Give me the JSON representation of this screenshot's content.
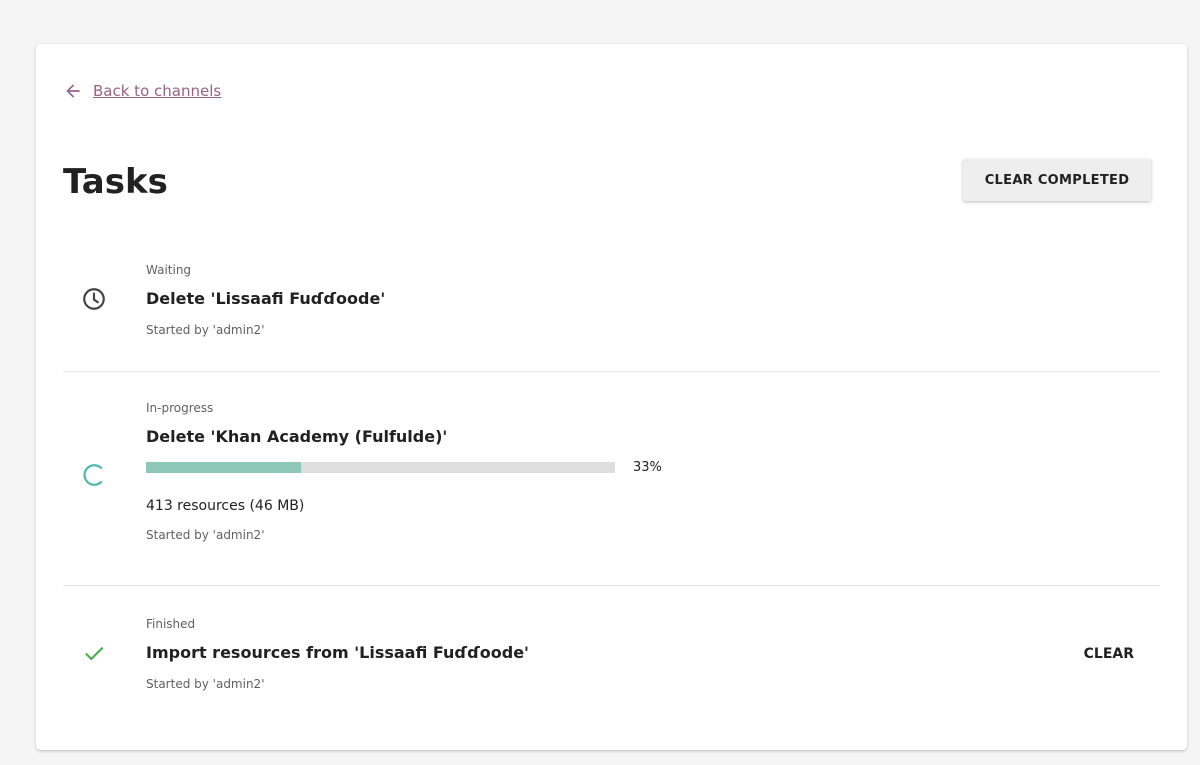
{
  "nav": {
    "back_label": "Back to channels",
    "link_color": "#996189"
  },
  "page": {
    "title": "Tasks",
    "clear_completed_label": "CLEAR COMPLETED"
  },
  "tasks": [
    {
      "status": "Waiting",
      "status_icon": "clock-icon",
      "title": "Delete 'Lissaafi Fuɗɗoode'",
      "started_by": "Started by 'admin2'"
    },
    {
      "status": "In-progress",
      "status_icon": "spinner-icon",
      "title": "Delete 'Khan Academy (Fulfulde)'",
      "progress": 0.33,
      "progress_label": "33%",
      "resources": "413 resources (46 MB)",
      "started_by": "Started by 'admin2'"
    },
    {
      "status": "Finished",
      "status_icon": "checkmark-icon",
      "title": "Import resources from 'Lissaafi Fuɗɗoode'",
      "started_by": "Started by 'admin2'",
      "clear_label": "CLEAR"
    }
  ],
  "colors": {
    "accent": "#996189",
    "progress_fill": "#8fc7b6",
    "progress_track": "#dedede",
    "success": "#4caf50",
    "spinner": "#4db6ac"
  }
}
